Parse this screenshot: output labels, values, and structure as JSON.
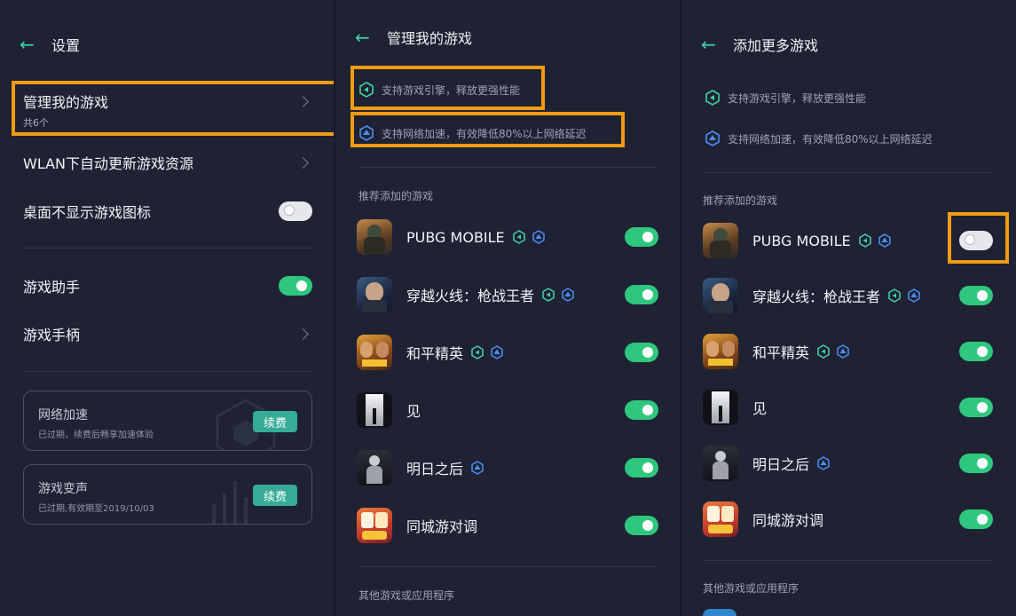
{
  "colors": {
    "accent": "#43d1a6",
    "toggle_on": "#2fc77e",
    "highlight": "#f29b12",
    "renew": "#36ac98"
  },
  "settings": {
    "title": "设置",
    "items": [
      {
        "label": "管理我的游戏",
        "sub": "共6个"
      },
      {
        "label": "WLAN下自动更新游戏资源"
      },
      {
        "label": "桌面不显示游戏图标",
        "toggle": "off"
      },
      {
        "label": "游戏助手",
        "toggle": "on"
      },
      {
        "label": "游戏手柄"
      }
    ],
    "cards": [
      {
        "title": "网络加速",
        "sub": "已过期，续费后畅享加速体验",
        "button": "续费"
      },
      {
        "title": "游戏变声",
        "sub": "已过期,有效期至2019/10/03",
        "button": "续费"
      }
    ]
  },
  "manage": {
    "title": "管理我的游戏",
    "features": [
      "支持游戏引擎，释放更强性能",
      "支持网络加速，有效降低80%以上网络延迟"
    ],
    "recommended_label": "推荐添加的游戏",
    "other_label": "其他游戏或应用程序",
    "games": [
      {
        "name": "PUBG MOBILE",
        "toggle": "on"
      },
      {
        "name": "穿越火线：枪战王者",
        "toggle": "on"
      },
      {
        "name": "和平精英",
        "toggle": "on"
      },
      {
        "name": "见",
        "toggle": "on"
      },
      {
        "name": "明日之后",
        "toggle": "on"
      },
      {
        "name": "同城游对调",
        "toggle": "on"
      }
    ]
  },
  "add_more": {
    "title": "添加更多游戏",
    "features": [
      "支持游戏引擎，释放更强性能",
      "支持网络加速，有效降低80%以上网络延迟"
    ],
    "recommended_label": "推荐添加的游戏",
    "other_label": "其他游戏或应用程序",
    "games": [
      {
        "name": "PUBG MOBILE",
        "toggle": "off"
      },
      {
        "name": "穿越火线：枪战王者",
        "toggle": "on"
      },
      {
        "name": "和平精英",
        "toggle": "on"
      },
      {
        "name": "见",
        "toggle": "on"
      },
      {
        "name": "明日之后",
        "toggle": "on"
      },
      {
        "name": "同城游对调",
        "toggle": "on"
      }
    ]
  }
}
